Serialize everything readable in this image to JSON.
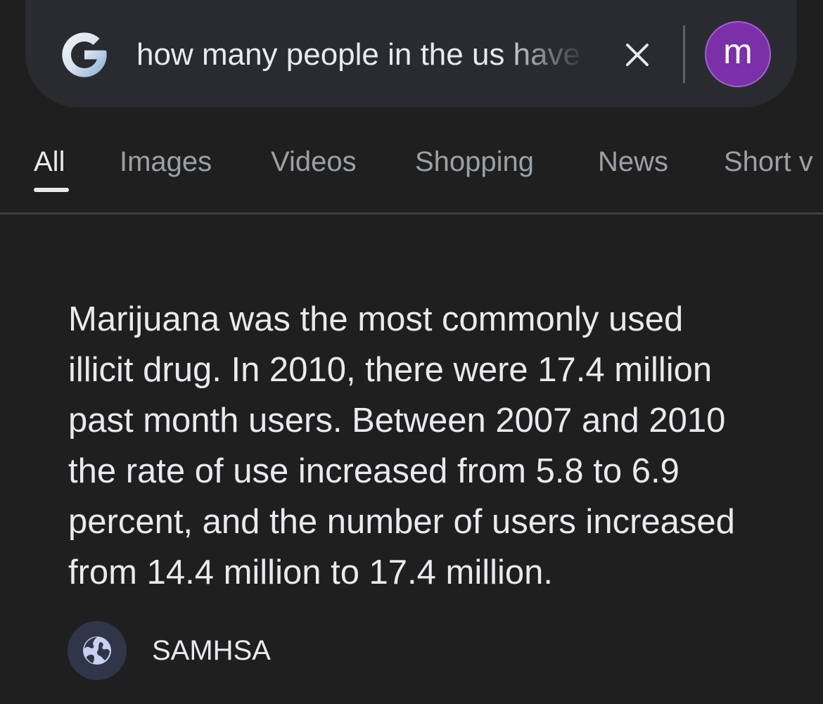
{
  "search": {
    "query": "how many people in the us have"
  },
  "account": {
    "initial": "m",
    "color": "#7b2fa8"
  },
  "icons": {
    "logo": "google-g-icon",
    "clear": "close-icon",
    "source": "globe-icon"
  },
  "tabs": [
    {
      "label": "All",
      "active": true
    },
    {
      "label": "Images"
    },
    {
      "label": "Videos"
    },
    {
      "label": "Shopping"
    },
    {
      "label": "News"
    },
    {
      "label": "Short v"
    }
  ],
  "answer": {
    "lines": [
      "Marijuana was the most commonly used",
      "illicit drug. In 2010, there were 17.4 million",
      "past month users. Between 2007 and 2010",
      "the rate of use increased from 5.8 to 6.9",
      "percent, and the number of users increased",
      "from 14.4 million to 17.4 million."
    ]
  },
  "source": {
    "name": "SAMHSA"
  },
  "colors": {
    "background": "#1f1f1f",
    "search_bar": "#2a2b2f",
    "text": "#e8eaed",
    "tab_inactive": "#9aa0a6"
  }
}
